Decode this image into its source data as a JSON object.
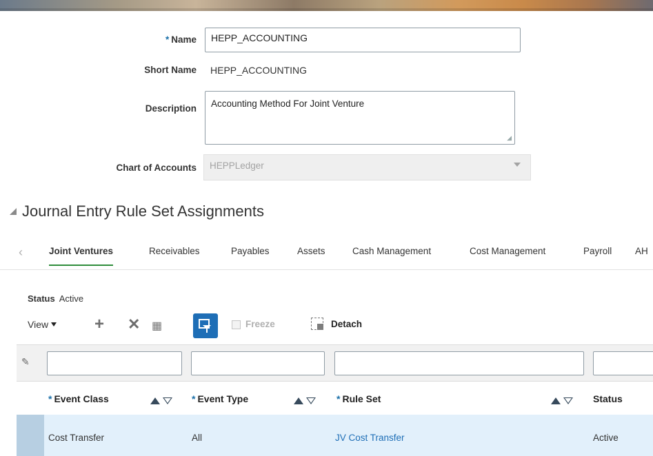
{
  "form": {
    "required_marker": "*",
    "name_label": "Name",
    "name_value": "HEPP_ACCOUNTING",
    "short_name_label": "Short Name",
    "short_name_value": "HEPP_ACCOUNTING",
    "description_label": "Description",
    "description_value": "Accounting Method For Joint Venture",
    "coa_label": "Chart of Accounts",
    "coa_value": "HEPPLedger"
  },
  "section": {
    "title": "Journal Entry Rule Set Assignments"
  },
  "tabs": [
    {
      "label": "Joint Ventures",
      "active": true
    },
    {
      "label": "Receivables"
    },
    {
      "label": "Payables"
    },
    {
      "label": "Assets"
    },
    {
      "label": "Cash Management"
    },
    {
      "label": "Cost Management"
    },
    {
      "label": "Payroll"
    },
    {
      "label": "AH"
    }
  ],
  "status": {
    "label": "Status",
    "value": "Active"
  },
  "toolbar": {
    "view_label": "View",
    "freeze_label": "Freeze",
    "detach_label": "Detach"
  },
  "table": {
    "required_marker": "*",
    "columns": [
      "Event Class",
      "Event Type",
      "Rule Set",
      "Status"
    ],
    "rows": [
      {
        "event_class": "Cost Transfer",
        "event_type": "All",
        "rule_set": "JV Cost Transfer",
        "status": "Active"
      }
    ]
  },
  "colors": {
    "accent": "#1e6eb6",
    "active_tab": "#2e8c3a",
    "selected_row": "#e2f0fb"
  }
}
